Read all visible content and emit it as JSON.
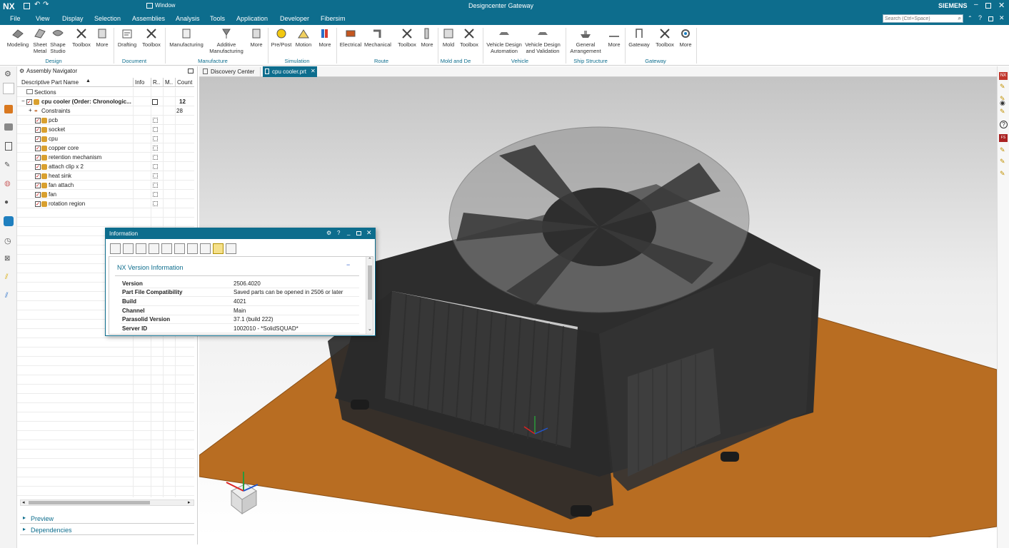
{
  "app": {
    "logo": "NX",
    "window_menu": "Window",
    "title": "Designcenter Gateway",
    "brand": "SIEMENS",
    "search_placeholder": "Search (Ctrl+Space)"
  },
  "menu": [
    "File",
    "View",
    "Display",
    "Selection",
    "Assemblies",
    "Analysis",
    "Tools",
    "Application",
    "Developer",
    "Fibersim"
  ],
  "ribbon": {
    "buttons": [
      {
        "l1": "Modeling",
        "l2": ""
      },
      {
        "l1": "Sheet",
        "l2": "Metal"
      },
      {
        "l1": "Shape",
        "l2": "Studio"
      },
      {
        "l1": "Toolbox",
        "l2": ""
      },
      {
        "l1": "More",
        "l2": ""
      },
      {
        "l1": "Drafting",
        "l2": ""
      },
      {
        "l1": "Toolbox",
        "l2": ""
      },
      {
        "l1": "Manufacturing",
        "l2": ""
      },
      {
        "l1": "Additive",
        "l2": "Manufacturing"
      },
      {
        "l1": "More",
        "l2": ""
      },
      {
        "l1": "Pre/Post",
        "l2": ""
      },
      {
        "l1": "Motion",
        "l2": ""
      },
      {
        "l1": "More",
        "l2": ""
      },
      {
        "l1": "Electrical",
        "l2": ""
      },
      {
        "l1": "Mechanical",
        "l2": ""
      },
      {
        "l1": "Toolbox",
        "l2": ""
      },
      {
        "l1": "More",
        "l2": ""
      },
      {
        "l1": "Mold",
        "l2": ""
      },
      {
        "l1": "Toolbox",
        "l2": ""
      },
      {
        "l1": "Vehicle Design",
        "l2": "Automation"
      },
      {
        "l1": "Vehicle Design",
        "l2": "and Validation"
      },
      {
        "l1": "General",
        "l2": "Arrangement"
      },
      {
        "l1": "More",
        "l2": ""
      },
      {
        "l1": "Gateway",
        "l2": ""
      },
      {
        "l1": "Toolbox",
        "l2": ""
      },
      {
        "l1": "More",
        "l2": ""
      }
    ],
    "groups": [
      "Design",
      "Document",
      "Manufacture",
      "Simulation",
      "Route",
      "Mold and De",
      "Vehicle",
      "Ship Structure",
      "Gateway"
    ]
  },
  "navigator": {
    "title": "Assembly Navigator",
    "columns": [
      "Descriptive Part Name",
      "Info",
      "R..",
      "M..",
      "Count"
    ],
    "sections": "Sections",
    "root": {
      "name": "cpu cooler (Order: Chronologic...",
      "count": "12"
    },
    "constraints": {
      "name": "Constraints",
      "count": "28"
    },
    "parts": [
      "pcb",
      "socket",
      "cpu",
      "copper core",
      "retention mechanism",
      "attach clip x 2",
      "heat sink",
      "fan attach",
      "fan",
      "rotation region"
    ],
    "footer": [
      "Preview",
      "Dependencies"
    ]
  },
  "tabs": [
    "Discovery Center",
    "cpu cooler.prt"
  ],
  "info": {
    "title": "Information",
    "section": "NX Version Information",
    "rows": [
      {
        "k": "Version",
        "v": "2506.4020"
      },
      {
        "k": "Part File Compatibility",
        "v": "Saved parts can be opened in 2506 or later"
      },
      {
        "k": "Build",
        "v": "4021"
      },
      {
        "k": "Channel",
        "v": "Main"
      },
      {
        "k": "Parasolid Version",
        "v": "37.1 (build 222)"
      },
      {
        "k": "Server ID",
        "v": "1002010 - *SolidSQUAD*"
      }
    ]
  },
  "colors": {
    "accent": "#0d6d8d",
    "highlight": "#f0c000",
    "plate": "#b86d22",
    "cooler": "#2b2b2b"
  }
}
